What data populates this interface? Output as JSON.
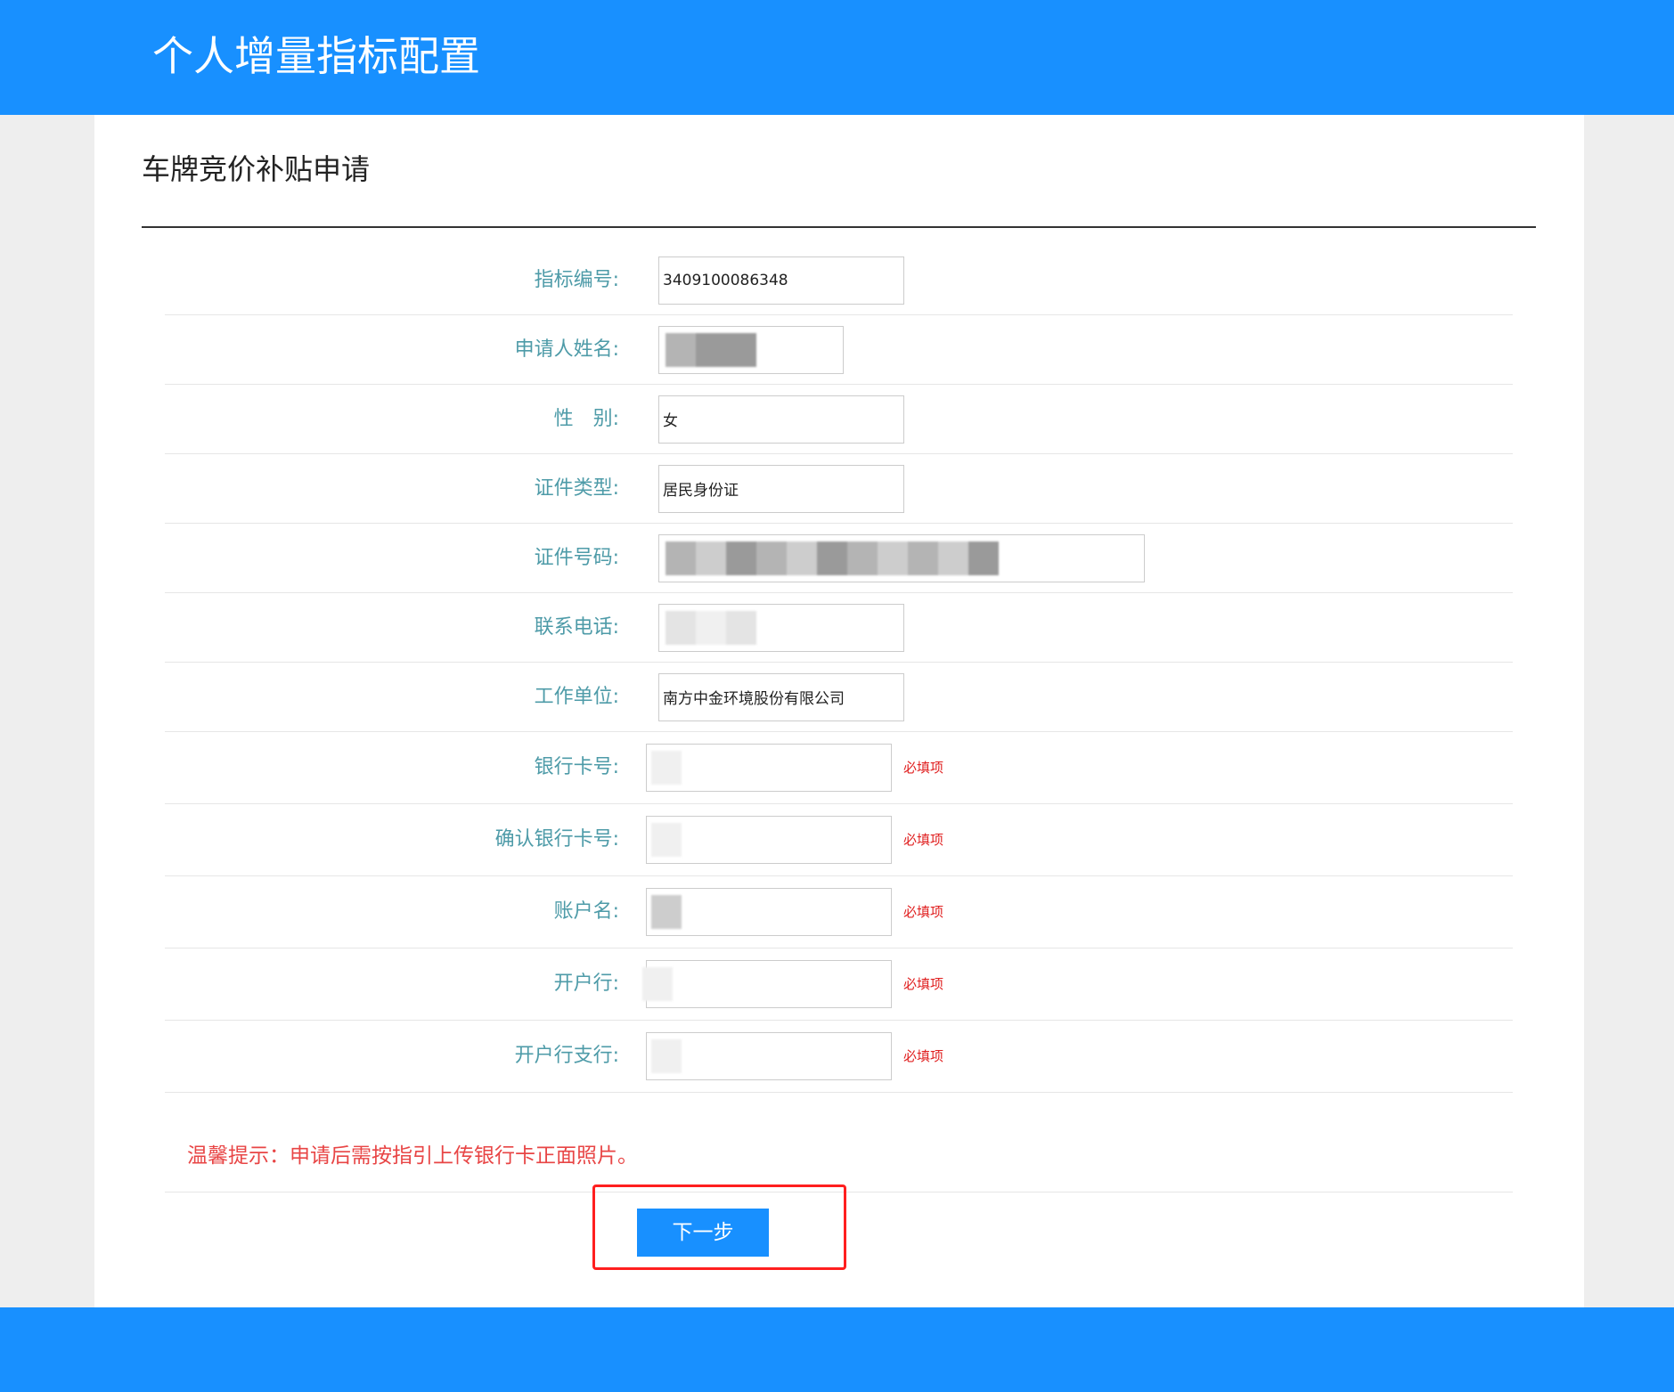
{
  "header": {
    "title": "个人增量指标配置"
  },
  "page": {
    "title": "车牌竞价补贴申请"
  },
  "form": {
    "fields": [
      {
        "label": "指标编号:",
        "value": "3409100086348"
      },
      {
        "label": "申请人姓名:",
        "value": ""
      },
      {
        "label": "性　别:",
        "value": "女"
      },
      {
        "label": "证件类型:",
        "value": "居民身份证"
      },
      {
        "label": "证件号码:",
        "value": ""
      },
      {
        "label": "联系电话:",
        "value": ""
      },
      {
        "label": "工作单位:",
        "value": "南方中金环境股份有限公司"
      },
      {
        "label": "银行卡号:",
        "value": "",
        "note": "必填项"
      },
      {
        "label": "确认银行卡号:",
        "value": "",
        "note": "必填项"
      },
      {
        "label": "账户名:",
        "value": "",
        "note": "必填项"
      },
      {
        "label": "开户行:",
        "value": "",
        "note": "必填项"
      },
      {
        "label": "开户行支行:",
        "value": "",
        "note": "必填项"
      }
    ]
  },
  "tip": {
    "text": "温馨提示：申请后需按指引上传银行卡正面照片。"
  },
  "actions": {
    "next_label": "下一步"
  },
  "colors": {
    "brand": "#1890ff",
    "label": "#4e9ba8",
    "required": "#e02020",
    "tip": "#e84545",
    "highlight": "#ff1f1f"
  }
}
